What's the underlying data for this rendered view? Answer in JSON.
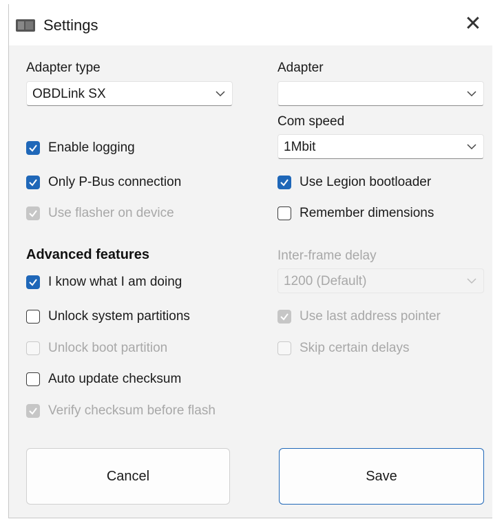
{
  "window": {
    "title": "Settings",
    "close_glyph": "✕"
  },
  "left": {
    "adapter_type_label": "Adapter type",
    "adapter_type_value": "OBDLink SX",
    "enable_logging": {
      "label": "Enable logging",
      "checked": true,
      "enabled": true
    },
    "only_pbus": {
      "label": "Only P-Bus connection",
      "checked": true,
      "enabled": true
    },
    "use_flasher": {
      "label": "Use flasher on device",
      "checked": true,
      "enabled": false
    }
  },
  "advanced": {
    "heading": "Advanced features",
    "know_what": {
      "label": "I know what I am doing",
      "checked": true,
      "enabled": true
    },
    "unlock_system": {
      "label": "Unlock system partitions",
      "checked": false,
      "enabled": true
    },
    "unlock_boot": {
      "label": "Unlock boot partition",
      "checked": false,
      "enabled": false
    },
    "auto_update": {
      "label": "Auto update checksum",
      "checked": false,
      "enabled": true
    },
    "verify_checksum": {
      "label": "Verify checksum before flash",
      "checked": true,
      "enabled": false
    }
  },
  "right": {
    "adapter_label": "Adapter",
    "adapter_value": "",
    "com_speed_label": "Com speed",
    "com_speed_value": "1Mbit",
    "legion_bootloader": {
      "label": "Use Legion bootloader",
      "checked": true,
      "enabled": true
    },
    "remember_dims": {
      "label": "Remember dimensions",
      "checked": false,
      "enabled": true
    },
    "inter_frame_label": "Inter-frame delay",
    "inter_frame_value": "1200 (Default)",
    "last_address": {
      "label": "Use last address pointer",
      "checked": true,
      "enabled": false
    },
    "skip_delays": {
      "label": "Skip certain delays",
      "checked": false,
      "enabled": false
    }
  },
  "buttons": {
    "cancel": "Cancel",
    "save": "Save"
  },
  "colors": {
    "accent": "#1f67b8",
    "disabled_text": "#a8a8a8",
    "window_bg": "#f3f3f3"
  }
}
